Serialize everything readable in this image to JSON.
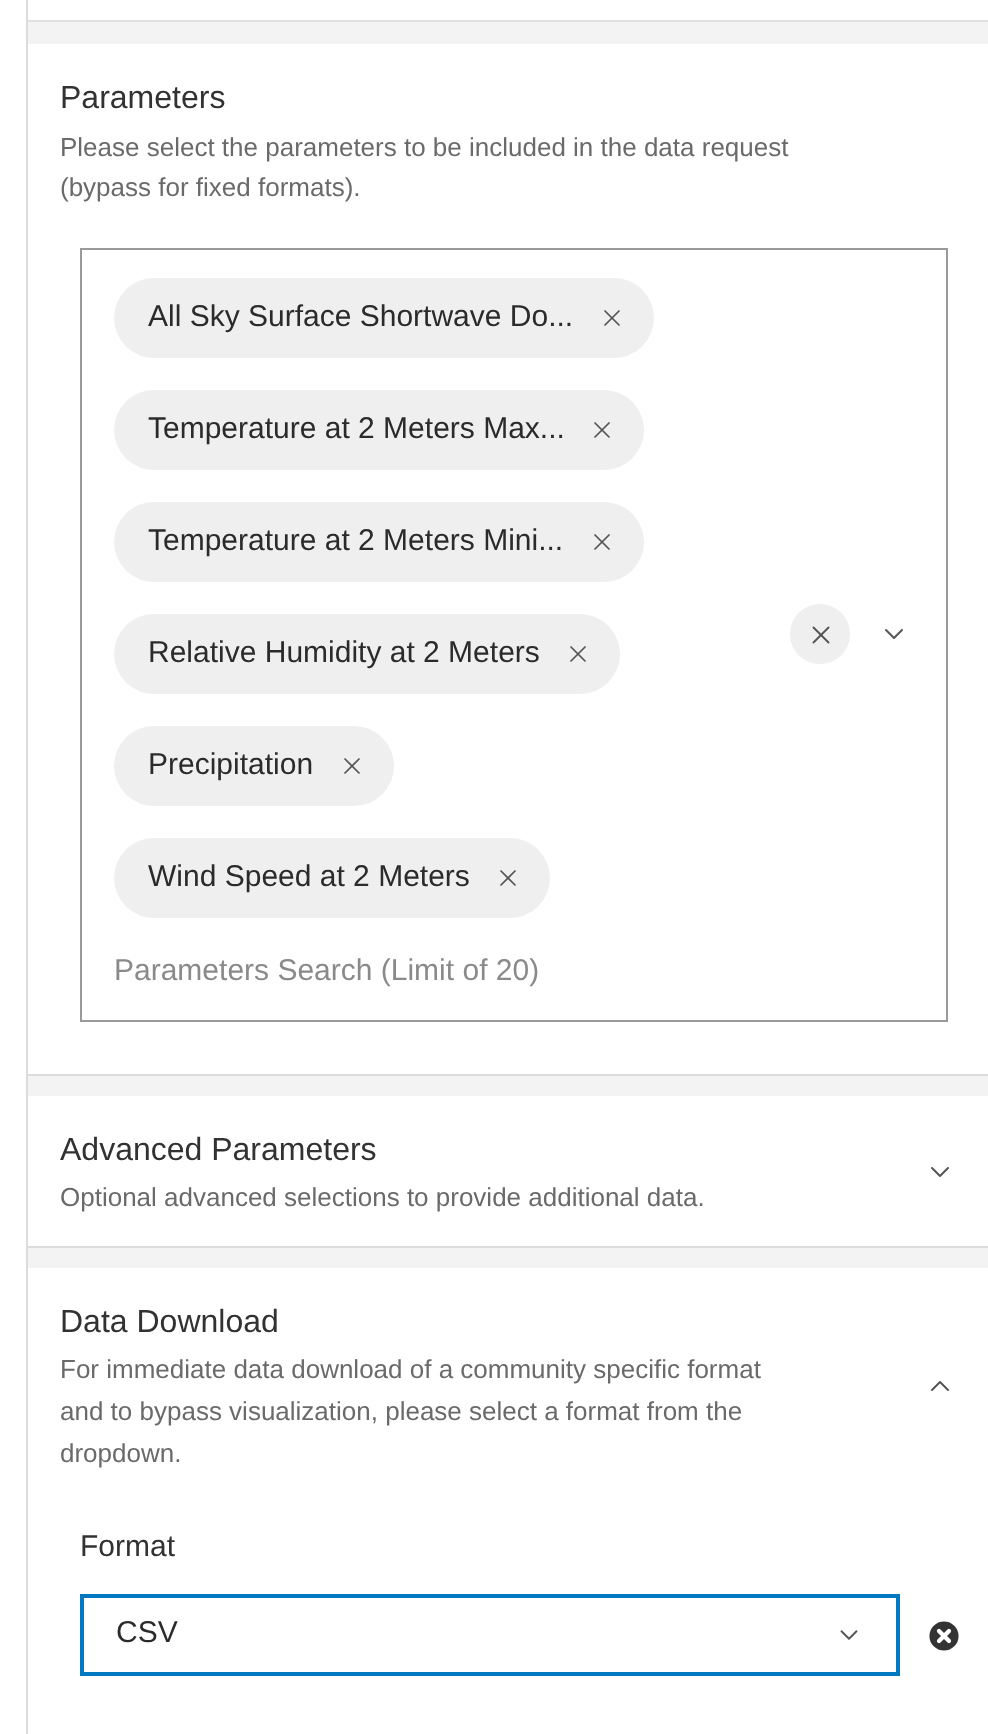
{
  "parameters": {
    "title": "Parameters",
    "description": "Please select the parameters to be included in the data request (bypass for fixed formats).",
    "chips": [
      {
        "label": "All Sky Surface Shortwave Do..."
      },
      {
        "label": "Temperature at 2 Meters Max..."
      },
      {
        "label": "Temperature at 2 Meters Mini..."
      },
      {
        "label": "Relative Humidity at 2 Meters"
      },
      {
        "label": "Precipitation"
      },
      {
        "label": "Wind Speed at 2 Meters"
      }
    ],
    "search": {
      "placeholder": "Parameters Search (Limit of 20)"
    }
  },
  "sections": [
    {
      "title": "Advanced Parameters",
      "description": "Optional advanced selections to provide additional data.",
      "expanded": false
    },
    {
      "title": "Data Download",
      "description": "For immediate data download of a community specific format and to bypass visualization, please select a format from the dropdown.",
      "expanded": true,
      "field": {
        "label": "Format",
        "value": "CSV"
      }
    }
  ]
}
